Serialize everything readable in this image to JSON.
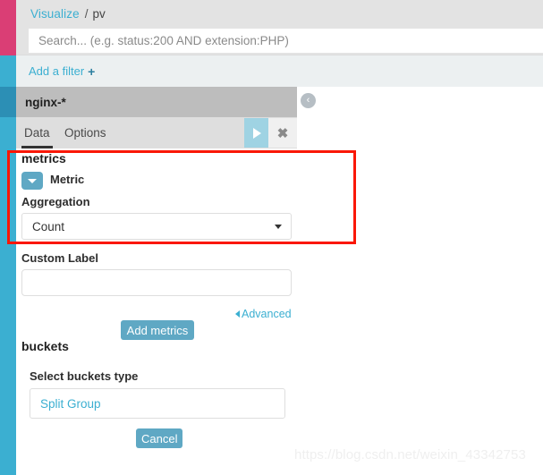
{
  "rail": {
    "accent_pink": "#DA3E75",
    "accent_teal": "#3BAFD1"
  },
  "breadcrumb": {
    "root": "Visualize",
    "separator": "/",
    "current": "pv"
  },
  "search": {
    "value": "",
    "placeholder": "Search... (e.g. status:200 AND extension:PHP)"
  },
  "filter_bar": {
    "add_filter_label": "Add a filter",
    "plus_icon": "+"
  },
  "panel": {
    "title": "nginx-*",
    "collapse_icon": "‹",
    "tabs": [
      {
        "label": "Data",
        "active": true
      },
      {
        "label": "Options",
        "active": false
      }
    ],
    "apply_icon": "play-icon",
    "close_icon": "✖"
  },
  "metrics": {
    "section_title": "metrics",
    "metric_toggle_label": "Metric",
    "aggregation_label": "Aggregation",
    "aggregation_value": "Count",
    "custom_label_label": "Custom Label",
    "custom_label_value": "",
    "advanced_label": "Advanced",
    "add_metrics_label": "Add metrics"
  },
  "buckets": {
    "section_title": "buckets",
    "select_label": "Select buckets type",
    "option_label": "Split Group",
    "cancel_label": "Cancel"
  },
  "watermark": {
    "text": "https://blog.csdn.net/weixin_43342753"
  }
}
